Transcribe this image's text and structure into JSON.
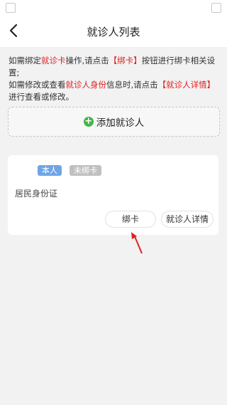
{
  "header": {
    "title": "就诊人列表"
  },
  "notice": {
    "line1_a": "如需绑定",
    "line1_hl": "就诊卡",
    "line1_b": "操作,请点击",
    "line1_btn": "【绑卡】",
    "line1_c": "按钮进行绑卡相关设置;",
    "line2_a": "如需修改或查看",
    "line2_hl": "就诊人身份",
    "line2_b": "信息时,请点击",
    "line2_btn": "【就诊人详情】",
    "line2_c": "进行查看或修改。"
  },
  "add_patient": {
    "label": "添加就诊人",
    "icon": "plus-circle-icon"
  },
  "patient_card": {
    "badge_self": "本人",
    "badge_unbound": "未绑卡",
    "id_type": "居民身份证",
    "bind_label": "绑卡",
    "detail_label": "就诊人详情"
  },
  "colors": {
    "highlight": "#e02020",
    "add_icon": "#43b649",
    "badge_self": "#6fa5e6",
    "badge_unbound": "#c0c0c0",
    "arrow": "#e02020"
  }
}
